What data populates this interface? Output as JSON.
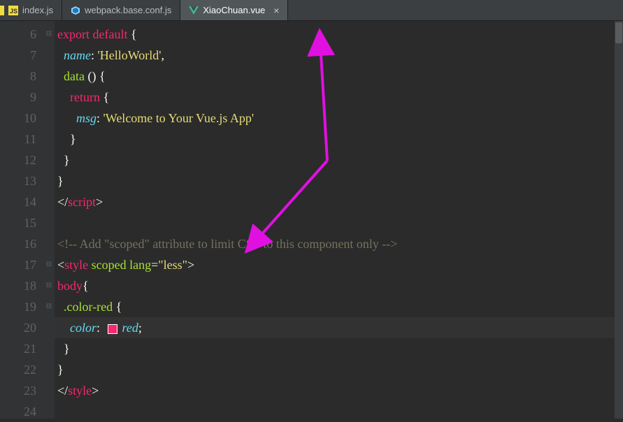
{
  "tabs": [
    {
      "label": "index.js",
      "icon": "js"
    },
    {
      "label": "webpack.base.conf.js",
      "icon": "webpack"
    },
    {
      "label": "XiaoChuan.vue",
      "icon": "vue",
      "active": true,
      "closable": true
    }
  ],
  "lineStart": 6,
  "lineEnd": 24,
  "highlightedLine": 20,
  "code": {
    "l6": {
      "export": "export",
      "default": "default",
      "brace": " {"
    },
    "l7": {
      "name": "name",
      "colon": ": ",
      "val": "'HelloWorld'",
      "comma": ","
    },
    "l8": {
      "data": "data",
      "paren": " () ",
      "brace": "{"
    },
    "l9": {
      "return": "return",
      "brace": " {"
    },
    "l10": {
      "msg": "msg",
      "colon": ": ",
      "val": "'Welcome to Your Vue.js App'"
    },
    "l11": {
      "brace": "}"
    },
    "l12": {
      "brace": "}"
    },
    "l13": {
      "brace": "}"
    },
    "l14": {
      "open": "</",
      "tag": "script",
      "close": ">"
    },
    "l16": {
      "comment": "<!-- Add \"scoped\" attribute to limit CSS to this component only -->"
    },
    "l17": {
      "open": "<",
      "tag": "style",
      "attr1": " scoped",
      "attr2": " lang",
      "eq": "=",
      "val": "\"less\"",
      "close": ">"
    },
    "l18": {
      "sel": "body",
      "brace": "{"
    },
    "l19": {
      "sel": ".color-red",
      "brace": " {"
    },
    "l20": {
      "prop": "color",
      "colon": ":  ",
      "val": "red",
      "semi": ";"
    },
    "l21": {
      "brace": "}"
    },
    "l22": {
      "brace": "}"
    },
    "l23": {
      "open": "</",
      "tag": "style",
      "close": ">"
    }
  }
}
